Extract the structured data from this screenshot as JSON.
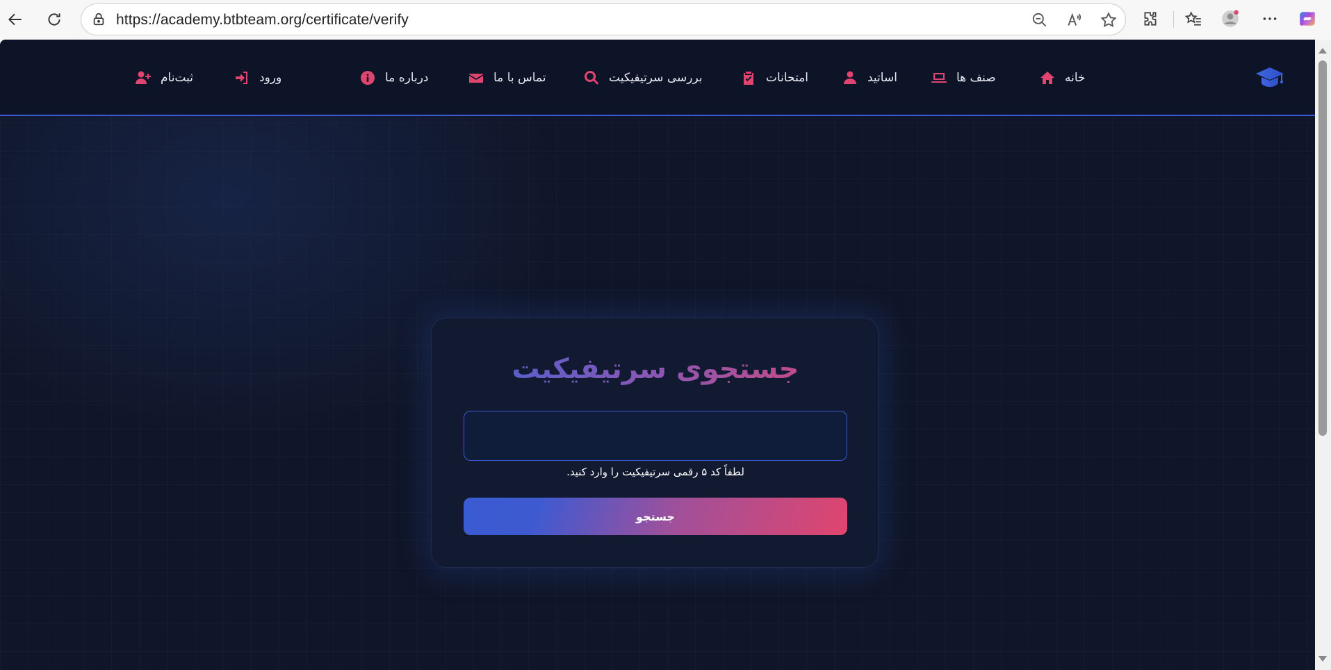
{
  "browser": {
    "url": "https://academy.btbteam.org/certificate/verify"
  },
  "site": {
    "nav": [
      {
        "label": "خانه",
        "icon": "home-icon"
      },
      {
        "label": "صنف ها",
        "icon": "laptop-icon"
      },
      {
        "label": "اساتید",
        "icon": "teacher-icon"
      },
      {
        "label": "امتحانات",
        "icon": "clipboard-check-icon"
      },
      {
        "label": "بررسی سرتیفیکیت",
        "icon": "search-icon"
      },
      {
        "label": "تماس با ما",
        "icon": "envelope-icon"
      },
      {
        "label": "درباره ما",
        "icon": "info-icon"
      },
      {
        "label": "ورود",
        "icon": "sign-in-icon"
      },
      {
        "label": "ثبت‌نام",
        "icon": "user-plus-icon"
      }
    ],
    "accent_color": "#e0456f",
    "brand_color": "#3c5ad6"
  },
  "certificate_search": {
    "title": "جستجوی سرتیفیکیت",
    "input_value": "",
    "hint": "لطفاً کد ۵ رقمی سرتیفیکیت را وارد کنید.",
    "button_label": "جستجو"
  }
}
